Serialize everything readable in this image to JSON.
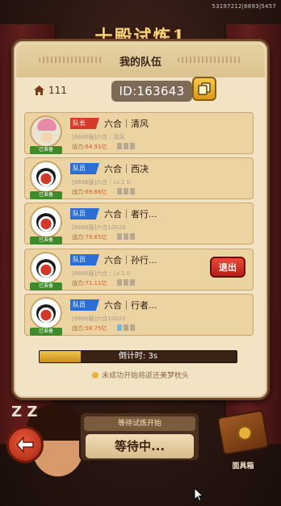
{
  "uid": "53197212|6693|5457",
  "title": "十殿试炼1",
  "panel_title": "我的队伍",
  "home": {
    "icon": "home-icon",
    "count": "111"
  },
  "team_id": "ID:163643",
  "members": [
    {
      "role": "队长",
      "name": "六合｜清风",
      "sub": "[6666服]六合｜清风",
      "power_label": "战力:",
      "power_value": "64.91亿",
      "slots": 3,
      "slots_on": 0,
      "ready": "已准备",
      "avatar": "chopper"
    },
    {
      "role": "队员",
      "name": "六合｜西决",
      "sub": "[6666服]六合｜Lv.1 0",
      "power_label": "战力:",
      "power_value": "69.86亿",
      "slots": 3,
      "slots_on": 0,
      "ready": "已准备",
      "avatar": "mask"
    },
    {
      "role": "队员",
      "name": "六合｜者行...",
      "sub": "[6666服]六合10020",
      "power_label": "战力:",
      "power_value": "79.65亿",
      "slots": 3,
      "slots_on": 0,
      "ready": "已准备",
      "avatar": "mask"
    },
    {
      "role": "队员",
      "name": "六合｜孙行...",
      "sub": "[6666服]六合｜Lv.1 0",
      "power_label": "战力:",
      "power_value": "71.11亿",
      "slots": 3,
      "slots_on": 0,
      "ready": "已准备",
      "avatar": "mask"
    },
    {
      "role": "队员",
      "name": "六合｜行者...",
      "sub": "[6666服]六合10020",
      "power_label": "战力:",
      "power_value": "58.75亿",
      "slots": 3,
      "slots_on": 1,
      "ready": "已准备",
      "avatar": "mask"
    }
  ],
  "exit_label": "退出",
  "countdown": {
    "label": "倒计时: 3s",
    "progress": 0.21
  },
  "notice": "未成功开始将返还美梦枕头",
  "wait": {
    "top": "等待试炼开始",
    "main": "等待中..."
  },
  "chest_label": "面具箱",
  "colors": {
    "leader": "#d63a2a",
    "member": "#2a6ed6",
    "ready": "#3f8a2a",
    "exit": "#d0281c",
    "bar": "#f4c24a"
  }
}
